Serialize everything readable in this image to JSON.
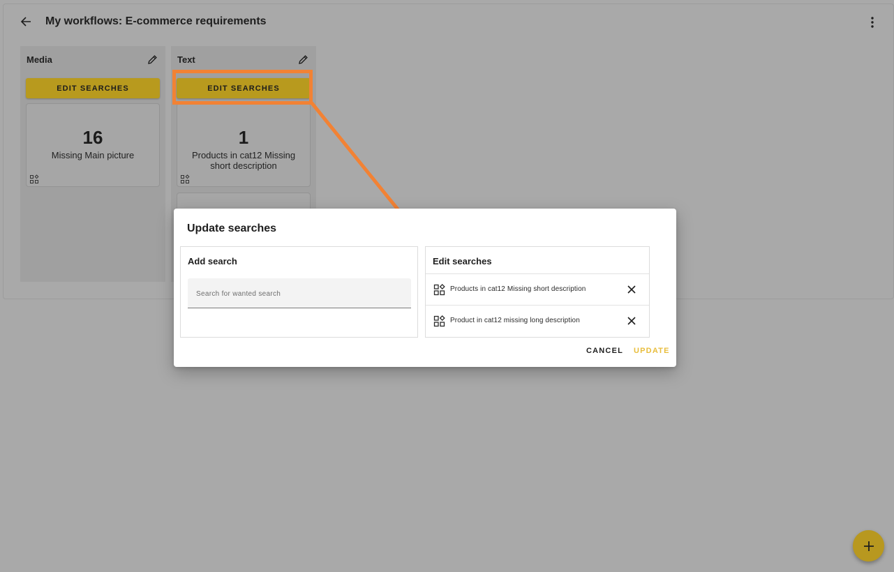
{
  "header": {
    "title": "My workflows: E-commerce requirements"
  },
  "columns": [
    {
      "title": "Media",
      "edit_searches_label": "EDIT SEARCHES",
      "cards": [
        {
          "count": "16",
          "label": "Missing Main picture"
        }
      ]
    },
    {
      "title": "Text",
      "edit_searches_label": "EDIT SEARCHES",
      "cards": [
        {
          "count": "1",
          "label": "Products in cat12 Missing short description"
        }
      ]
    }
  ],
  "dialog": {
    "title": "Update searches",
    "add_search": {
      "heading": "Add search",
      "placeholder": "Search for wanted search"
    },
    "edit_searches": {
      "heading": "Edit searches",
      "items": [
        {
          "label": "Products in cat12 Missing short description"
        },
        {
          "label": "Product in cat12 missing long description"
        }
      ]
    },
    "cancel_label": "CANCEL",
    "update_label": "UPDATE"
  },
  "colors": {
    "accent": "#b89a1e",
    "update_text": "#e8bd3c",
    "annotation": "#f28234",
    "backdrop": "#a9a9a9"
  },
  "icons": {
    "back": "arrow-left-icon",
    "menu": "more-vert-icon",
    "edit": "pencil-icon",
    "search_type": "widgets-icon",
    "remove": "close-icon",
    "fab": "plus-icon"
  }
}
